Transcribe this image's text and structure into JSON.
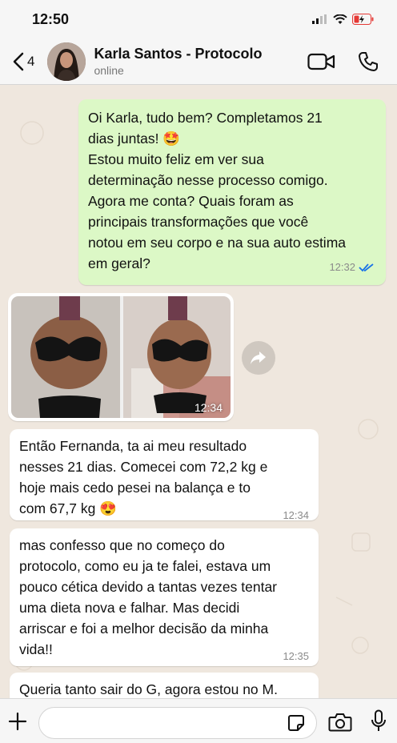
{
  "status_bar": {
    "time": "12:50"
  },
  "header": {
    "back_count": "4",
    "contact_name": "Karla Santos - Protocolo",
    "contact_status": "online"
  },
  "messages": [
    {
      "direction": "out",
      "text": "Oi Karla, tudo bem? Completamos 21\ndias juntas! 🤩\nEstou muito feliz em ver sua\ndeterminação nesse processo comigo.\nAgora me conta? Quais foram as\nprincipais transformações que você\nnotou em seu corpo e na sua auto estima\nem geral?",
      "time": "12:32",
      "read": true
    },
    {
      "direction": "in",
      "type": "photo",
      "time": "12:34"
    },
    {
      "direction": "in",
      "text": "Então Fernanda, ta ai meu resultado\nnesses 21 dias. Comecei com 72,2 kg e\nhoje mais cedo pesei na balança e to\ncom 67,7 kg 😍",
      "time": "12:34"
    },
    {
      "direction": "in",
      "text": "mas confesso que no começo do\nprotocolo, como eu ja te falei, estava um\npouco cética devido a tantas vezes tentar\numa dieta nova e falhar. Mas decidi\narriscar e foi a melhor decisão da minha\nvida!!",
      "time": "12:35"
    },
    {
      "direction": "in",
      "text": "Queria tanto sair do G, agora estou no M.",
      "time": ""
    }
  ],
  "colors": {
    "outgoing": "#dcf8c6",
    "incoming": "#ffffff",
    "accent": "#1a73e8",
    "background": "#efe7de"
  },
  "icons": [
    "chevron-left-icon",
    "video-call-icon",
    "phone-icon",
    "forward-icon",
    "plus-icon",
    "sticker-icon",
    "camera-icon",
    "microphone-icon"
  ]
}
